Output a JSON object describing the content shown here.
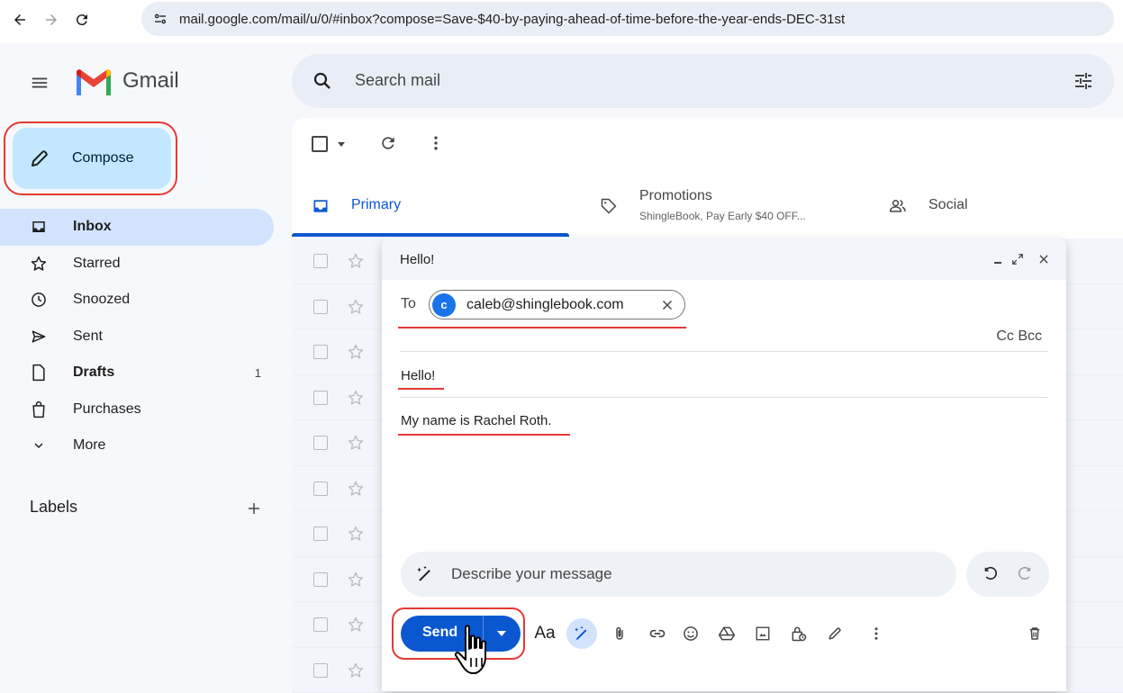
{
  "browser": {
    "url": "mail.google.com/mail/u/0/#inbox?compose=Save-$40-by-paying-ahead-of-time-before-the-year-ends-DEC-31st"
  },
  "app": {
    "name": "Gmail"
  },
  "compose_button": {
    "label": "Compose"
  },
  "nav": {
    "items": [
      {
        "label": "Inbox",
        "icon": "inbox-icon",
        "count": "",
        "active": true
      },
      {
        "label": "Starred",
        "icon": "star-icon",
        "count": ""
      },
      {
        "label": "Snoozed",
        "icon": "clock-icon",
        "count": ""
      },
      {
        "label": "Sent",
        "icon": "send-icon",
        "count": ""
      },
      {
        "label": "Drafts",
        "icon": "draft-icon",
        "count": "1"
      },
      {
        "label": "Purchases",
        "icon": "bag-icon",
        "count": ""
      },
      {
        "label": "More",
        "icon": "chevron-down-icon",
        "count": ""
      }
    ]
  },
  "labels": {
    "title": "Labels"
  },
  "search": {
    "placeholder": "Search mail"
  },
  "tabs": [
    {
      "label": "Primary",
      "active": true
    },
    {
      "label": "Promotions",
      "sub": "ShingleBook, Pay Early $40 OFF..."
    },
    {
      "label": "Social"
    }
  ],
  "compose_window": {
    "title": "Hello!",
    "to_label": "To",
    "recipient": {
      "initial": "c",
      "email": "caleb@shinglebook.com"
    },
    "cc_bcc": "Cc Bcc",
    "subject": "Hello!",
    "body": "My name is Rachel Roth.",
    "describe_placeholder": "Describe your message",
    "send_label": "Send",
    "format_label": "Aa"
  },
  "colors": {
    "accent": "#0b57d0",
    "compose_bg": "#c2e7ff",
    "active_nav": "#d3e3fd",
    "highlight": "#e53935"
  }
}
